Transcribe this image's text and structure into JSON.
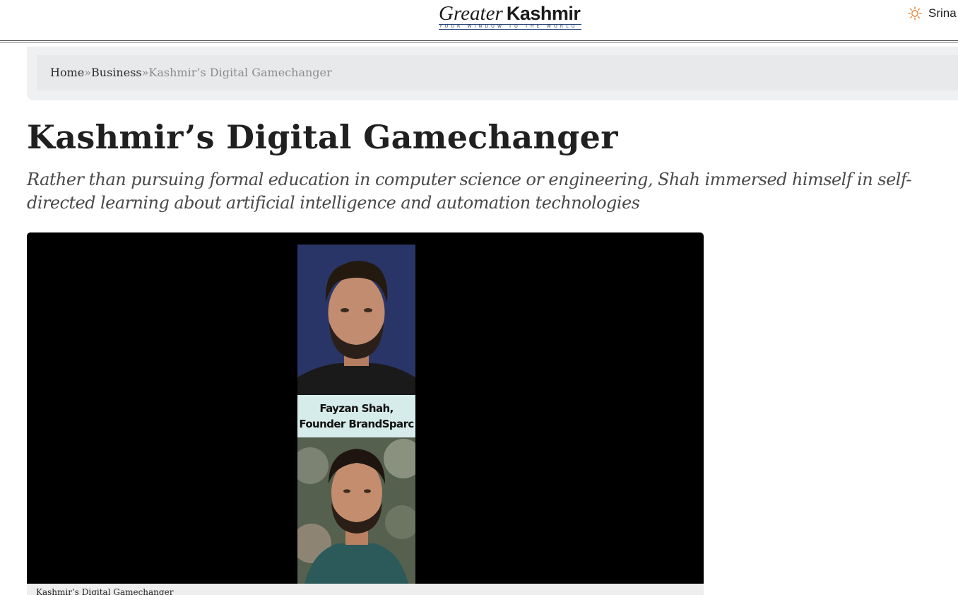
{
  "header": {
    "logo": {
      "greater": "Greater",
      "kashmir": "Kashmir",
      "tagline": "YOUR WINDOW TO THE WORLD"
    },
    "weather": {
      "icon": "sun-icon",
      "city": "Srina"
    }
  },
  "breadcrumb": {
    "home": "Home",
    "separator": "»",
    "section": "Business",
    "current": "Kashmir’s Digital Gamechanger"
  },
  "article": {
    "title": "Kashmir’s Digital Gamechanger",
    "subtitle": "Rather than pursuing formal education in computer science or engineering, Shah immersed himself in self-directed learning about artificial intelligence and automation technologies"
  },
  "media": {
    "card_line1": "Fayzan Shah,",
    "card_line2": "Founder BrandSparc",
    "caption": "Kashmir’s Digital Gamechanger"
  },
  "colors": {
    "sun_icon": "#e8792b",
    "tagline": "#1e3d73",
    "photo_top_bg": "#2a3567",
    "card_bg": "#d6ecea"
  }
}
